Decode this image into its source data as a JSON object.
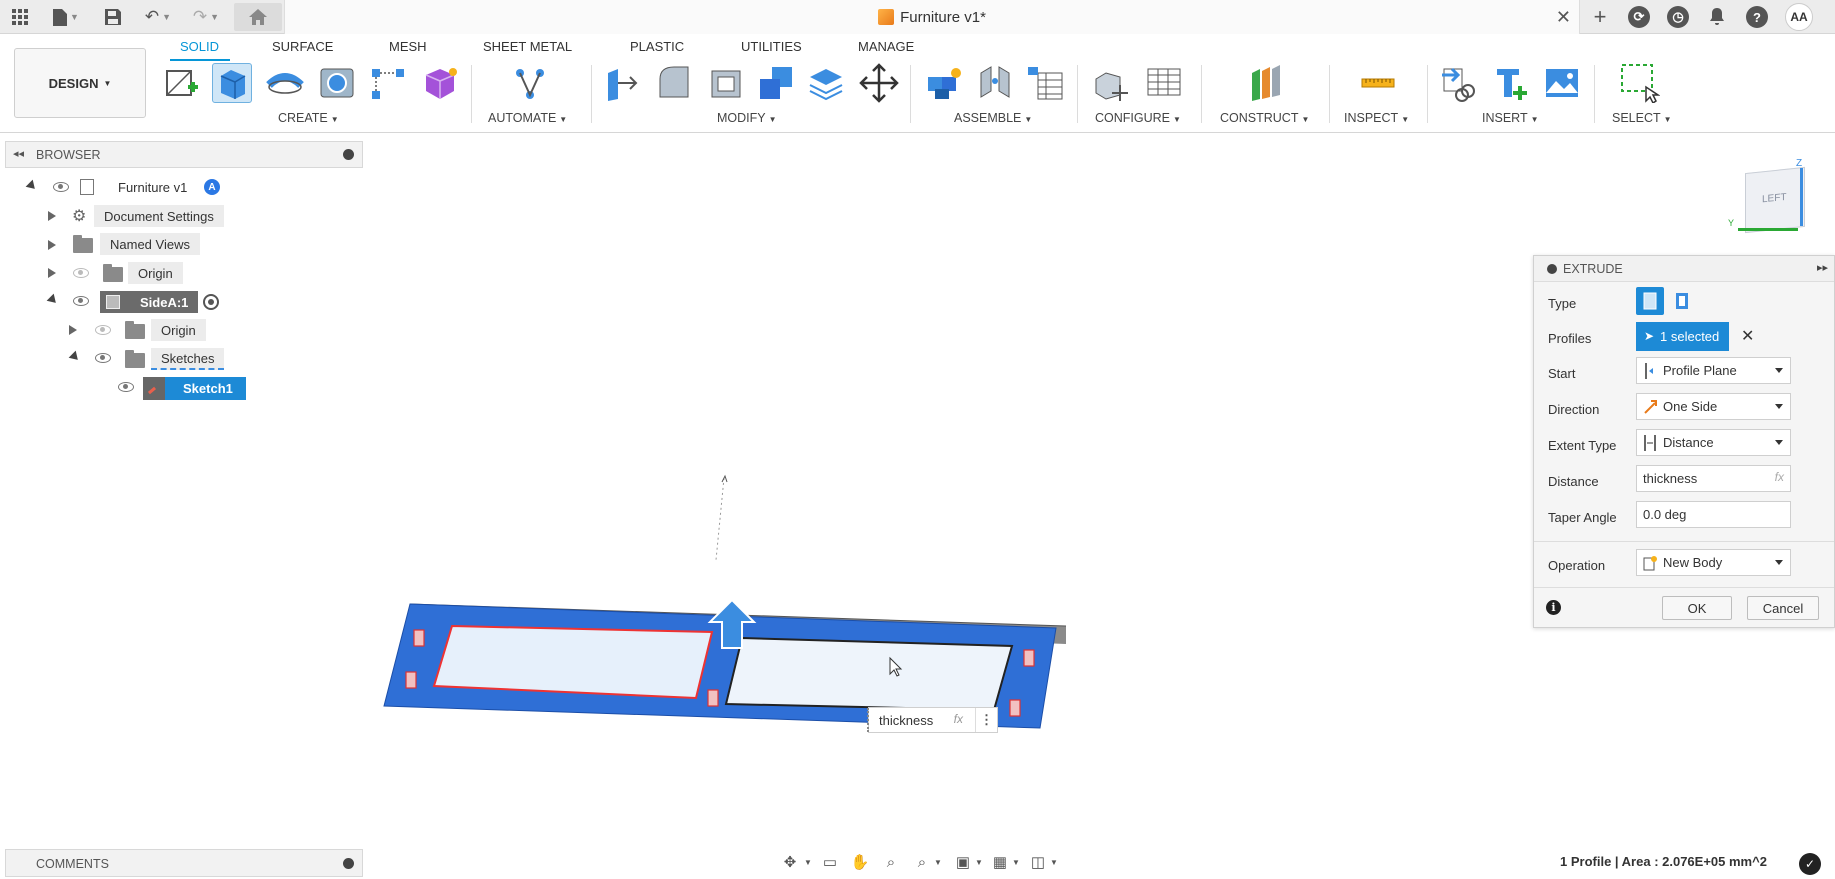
{
  "titlebar": {
    "document_title": "Furniture v1*"
  },
  "user": {
    "initials": "AA"
  },
  "ribbon": {
    "workspace": "DESIGN",
    "tabs": [
      "SOLID",
      "SURFACE",
      "MESH",
      "SHEET METAL",
      "PLASTIC",
      "UTILITIES",
      "MANAGE"
    ],
    "active_tab": "SOLID",
    "groups": {
      "create": "CREATE",
      "automate": "AUTOMATE",
      "modify": "MODIFY",
      "assemble": "ASSEMBLE",
      "configure": "CONFIGURE",
      "construct": "CONSTRUCT",
      "inspect": "INSPECT",
      "insert": "INSERT",
      "select": "SELECT"
    }
  },
  "browser": {
    "title": "BROWSER",
    "items": [
      {
        "label": "Furniture v1"
      },
      {
        "label": "Document Settings"
      },
      {
        "label": "Named Views"
      },
      {
        "label": "Origin"
      },
      {
        "label": "SideA:1"
      },
      {
        "label": "Origin"
      },
      {
        "label": "Sketches"
      },
      {
        "label": "Sketch1"
      }
    ],
    "active_badge": "A"
  },
  "comments": {
    "title": "COMMENTS"
  },
  "viewcube": {
    "face": "LEFT",
    "z": "Z",
    "y": "Y"
  },
  "extrude": {
    "title": "EXTRUDE",
    "type_label": "Type",
    "profiles_label": "Profiles",
    "profiles_value": "1 selected",
    "start_label": "Start",
    "start_value": "Profile Plane",
    "direction_label": "Direction",
    "direction_value": "One Side",
    "extent_label": "Extent Type",
    "extent_value": "Distance",
    "distance_label": "Distance",
    "distance_value": "thickness",
    "taper_label": "Taper Angle",
    "taper_value": "0.0 deg",
    "operation_label": "Operation",
    "operation_value": "New Body",
    "ok": "OK",
    "cancel": "Cancel",
    "fx": "fx"
  },
  "canvas": {
    "input_value": "thickness",
    "fx": "fx"
  },
  "status": {
    "text": "1 Profile | Area : 2.076E+05 mm^2"
  },
  "colors": {
    "accent": "#0696d7",
    "body_blue": "#2f6fd6",
    "profile_fill": "#e6f0fb"
  }
}
